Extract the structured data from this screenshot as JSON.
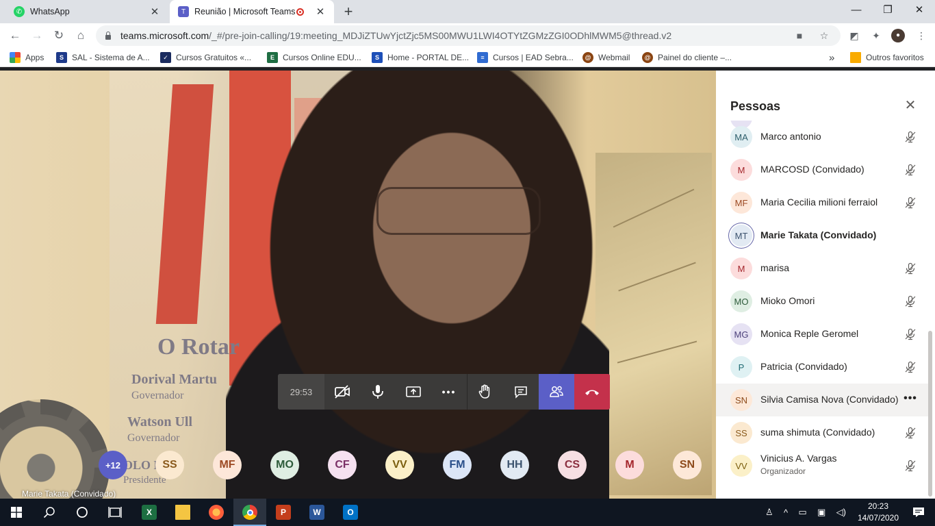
{
  "browser": {
    "tabs": [
      {
        "title": "WhatsApp",
        "active": false
      },
      {
        "title": "Reunião | Microsoft Teams",
        "active": true
      }
    ],
    "new_tab_label": "+",
    "close_tab_glyph": "✕",
    "window_controls": {
      "minimize": "—",
      "restore": "❐",
      "close": "✕"
    },
    "url_host": "teams.microsoft.com",
    "url_path": "/_#/pre-join-calling/19:meeting_MDJiZTUwYjctZjc5MS00MWU1LWI4OTYtZGMzZGI0ODhlMWM5@thread.v2",
    "bookmarks": [
      {
        "label": "Apps",
        "icon": "apps-grid-icon"
      },
      {
        "label": "SAL - Sistema de A...",
        "icon": "sal-icon"
      },
      {
        "label": "Cursos Gratuitos «...",
        "icon": "cursos-gratuitos-icon"
      },
      {
        "label": "Cursos Online EDU...",
        "icon": "edu-icon"
      },
      {
        "label": "Home - PORTAL DE...",
        "icon": "portal-icon"
      },
      {
        "label": "Cursos | EAD Sebra...",
        "icon": "sebrae-icon"
      },
      {
        "label": "Webmail",
        "icon": "webmail-icon"
      },
      {
        "label": "Painel do cliente –...",
        "icon": "painel-icon"
      }
    ],
    "more_bookmarks": "»",
    "other_bookmarks": "Outros favoritos"
  },
  "call": {
    "timer": "29:53",
    "video_label": "Marie Takata (Convidado)",
    "banner_line1": "O Rotar",
    "banner_line2": "Dorival Martu",
    "banner_line3": "Governador",
    "banner_line4": "Watson Ull",
    "banner_line5": "Governador",
    "banner_line6": "OLO KE",
    "banner_line7": "Presidente",
    "avatars": [
      {
        "initials": "+12",
        "bg": "#5b5fc7",
        "fg": "#ffffff"
      },
      {
        "initials": "SS",
        "bg": "#fbe9d0",
        "fg": "#8a5a1c"
      },
      {
        "initials": "MF",
        "bg": "#fde7d9",
        "fg": "#9c4a23"
      },
      {
        "initials": "MO",
        "bg": "#dfeee3",
        "fg": "#2d5b3a"
      },
      {
        "initials": "CF",
        "bg": "#f5e1f0",
        "fg": "#7a2f66"
      },
      {
        "initials": "VV",
        "bg": "#fbf0c8",
        "fg": "#7a5e0e"
      },
      {
        "initials": "FM",
        "bg": "#dce6f7",
        "fg": "#2a4f8a"
      },
      {
        "initials": "HH",
        "bg": "#e2eaf3",
        "fg": "#3d546f"
      },
      {
        "initials": "CS",
        "bg": "#f6dfe3",
        "fg": "#8a2e3f"
      },
      {
        "initials": "M",
        "bg": "#fcdcdc",
        "fg": "#a4262c"
      },
      {
        "initials": "SN",
        "bg": "#fde8d8",
        "fg": "#8e4b1b"
      }
    ]
  },
  "panel": {
    "title": "Pessoas",
    "participants": [
      {
        "initials": "MA",
        "name": "Marco antonio",
        "bg": "#e0eef2",
        "fg": "#2d5e6b",
        "muted": true
      },
      {
        "initials": "M",
        "name": "MARCOSD (Convidado)",
        "bg": "#fcdcdc",
        "fg": "#a4262c",
        "muted": true
      },
      {
        "initials": "MF",
        "name": "Maria Cecilia milioni ferraiol",
        "bg": "#fde7d9",
        "fg": "#9c4a23",
        "muted": true
      },
      {
        "initials": "MT",
        "name": "Marie Takata (Convidado)",
        "bg": "#e2eaf3",
        "fg": "#3d546f",
        "muted": false,
        "speaking": true
      },
      {
        "initials": "M",
        "name": "marisa",
        "bg": "#fcdcdc",
        "fg": "#a4262c",
        "muted": true
      },
      {
        "initials": "MO",
        "name": "Mioko Omori",
        "bg": "#dfeee3",
        "fg": "#2d5b3a",
        "muted": true
      },
      {
        "initials": "MG",
        "name": "Monica Reple Geromel",
        "bg": "#e6e2f3",
        "fg": "#4b3f7a",
        "muted": true
      },
      {
        "initials": "P",
        "name": "Patricia (Convidado)",
        "bg": "#dff1f3",
        "fg": "#1f6a73",
        "muted": true
      },
      {
        "initials": "SN",
        "name": "Silvia Camisa Nova (Convidado)",
        "bg": "#fde8d8",
        "fg": "#8e4b1b",
        "muted": false,
        "more": true
      },
      {
        "initials": "SS",
        "name": "suma shimuta (Convidado)",
        "bg": "#fbe9d0",
        "fg": "#8a5a1c",
        "muted": true
      },
      {
        "initials": "VV",
        "name": "Vinicius A. Vargas",
        "role": "Organizador",
        "bg": "#fbf0c8",
        "fg": "#7a5e0e",
        "muted": true
      }
    ],
    "more_glyph": "•••"
  },
  "taskbar": {
    "clock_time": "20:23",
    "clock_date": "14/07/2020",
    "apps": [
      "windows-start",
      "search",
      "cortana",
      "task-view",
      "excel",
      "file-explorer",
      "firefox",
      "chrome",
      "powerpoint",
      "word",
      "outlook"
    ]
  }
}
